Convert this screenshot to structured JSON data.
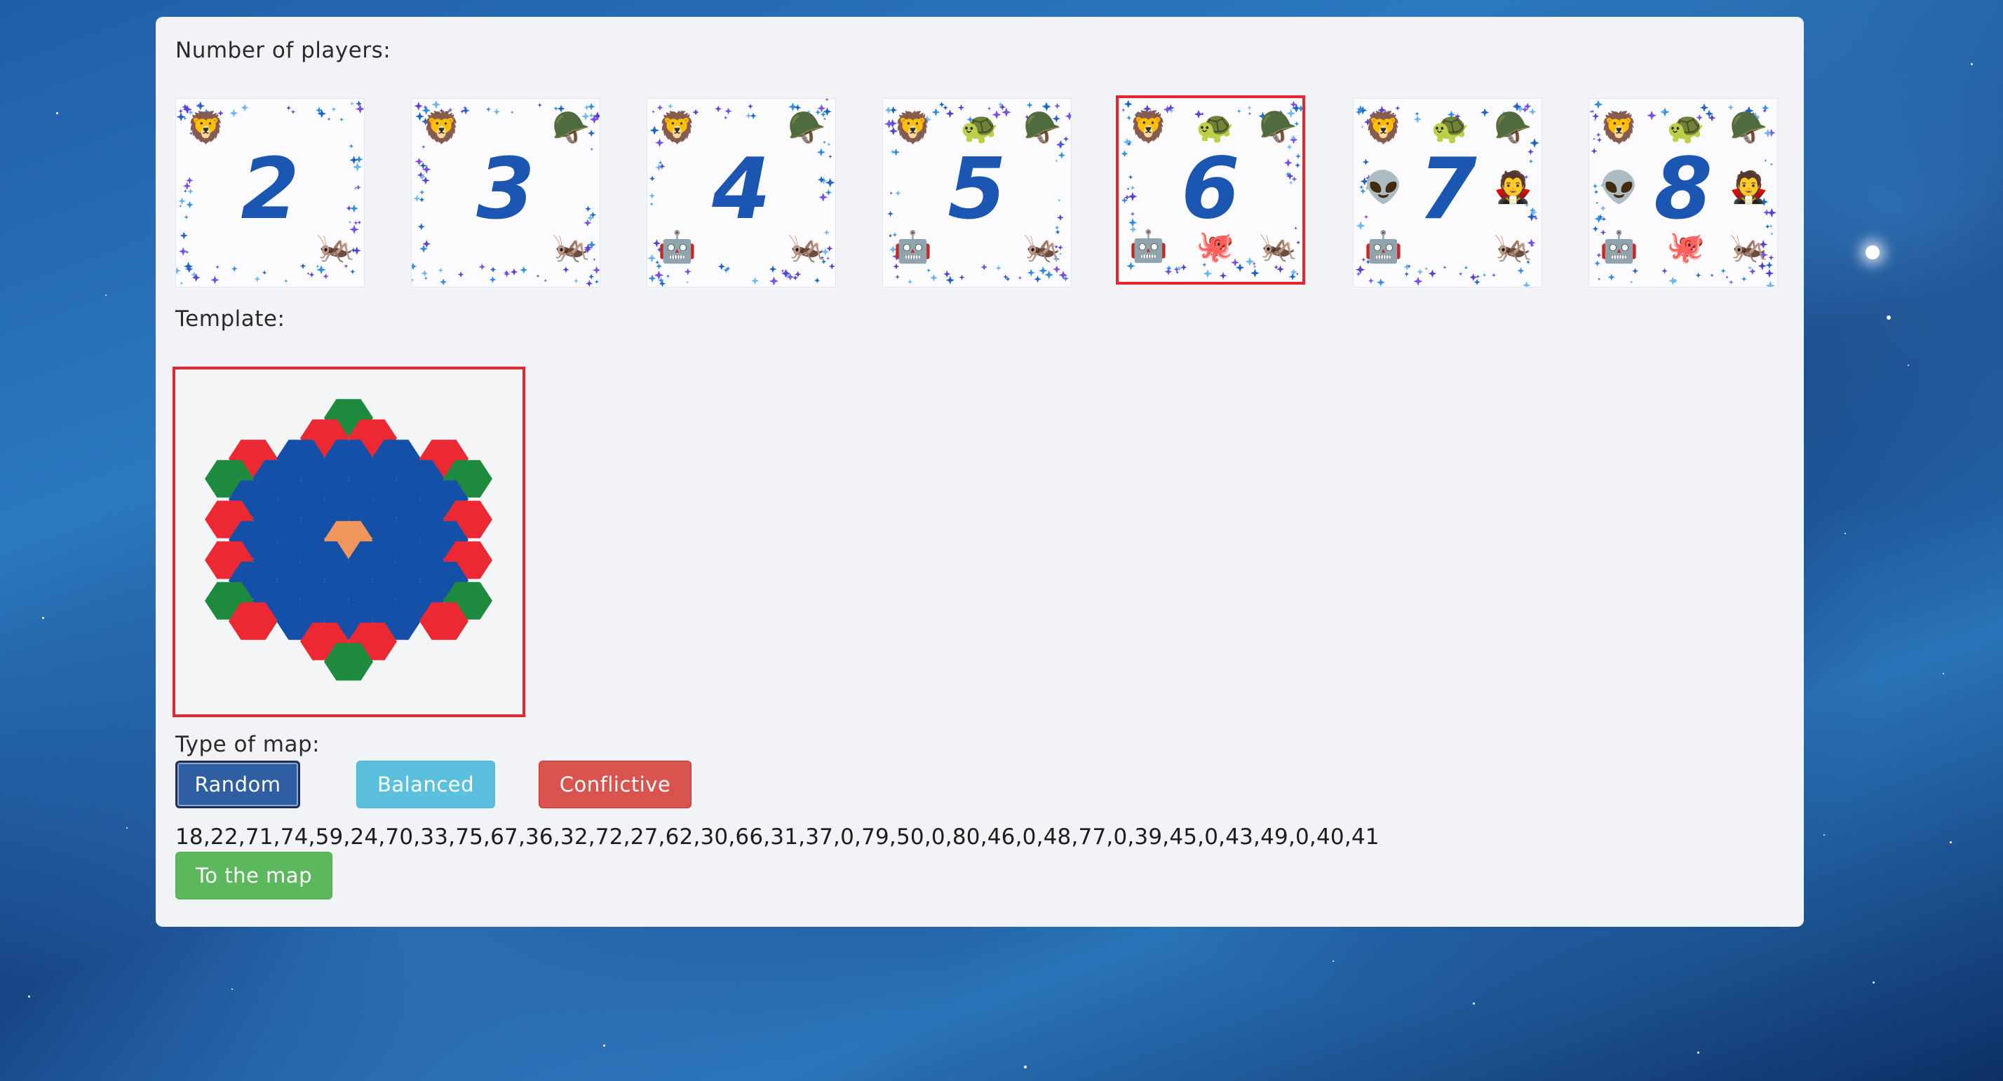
{
  "labels": {
    "players": "Number of players:",
    "template": "Template:",
    "map_type": "Type of map:"
  },
  "players": [
    {
      "number": "2",
      "emojis": [
        "🦁",
        "🦗"
      ]
    },
    {
      "number": "3",
      "emojis": [
        "🦁",
        "🪖",
        "🦗"
      ]
    },
    {
      "number": "4",
      "emojis": [
        "🦁",
        "🪖",
        "🤖",
        "🦗"
      ]
    },
    {
      "number": "5",
      "emojis": [
        "🦁",
        "🐢",
        "🪖",
        "🤖",
        "🦗"
      ]
    },
    {
      "number": "6",
      "emojis": [
        "🦁",
        "🐢",
        "🪖",
        "🤖",
        "🐙",
        "🦗"
      ]
    },
    {
      "number": "7",
      "emojis": [
        "🦁",
        "🐢",
        "🪖",
        "👽",
        "🧛",
        "🤖",
        "🦗"
      ]
    },
    {
      "number": "8",
      "emojis": [
        "🦁",
        "🐢",
        "🪖",
        "👽",
        "🧛",
        "🤖",
        "🐙",
        "🦗"
      ]
    }
  ],
  "selected_players": "6",
  "map_types": {
    "random": "Random",
    "balanced": "Balanced",
    "conflictive": "Conflictive"
  },
  "selected_map_type": "Random",
  "sequence": "18,22,71,74,59,24,70,33,75,67,36,32,72,27,62,30,66,31,37,0,79,50,0,80,46,0,48,77,0,39,45,0,43,49,0,40,41",
  "go_button": "To the map",
  "colors": {
    "red": "#ec2833",
    "blue": "#1450a8",
    "green": "#1e8a3e",
    "orange": "#f0955b",
    "selected_border": "#e4262f"
  }
}
